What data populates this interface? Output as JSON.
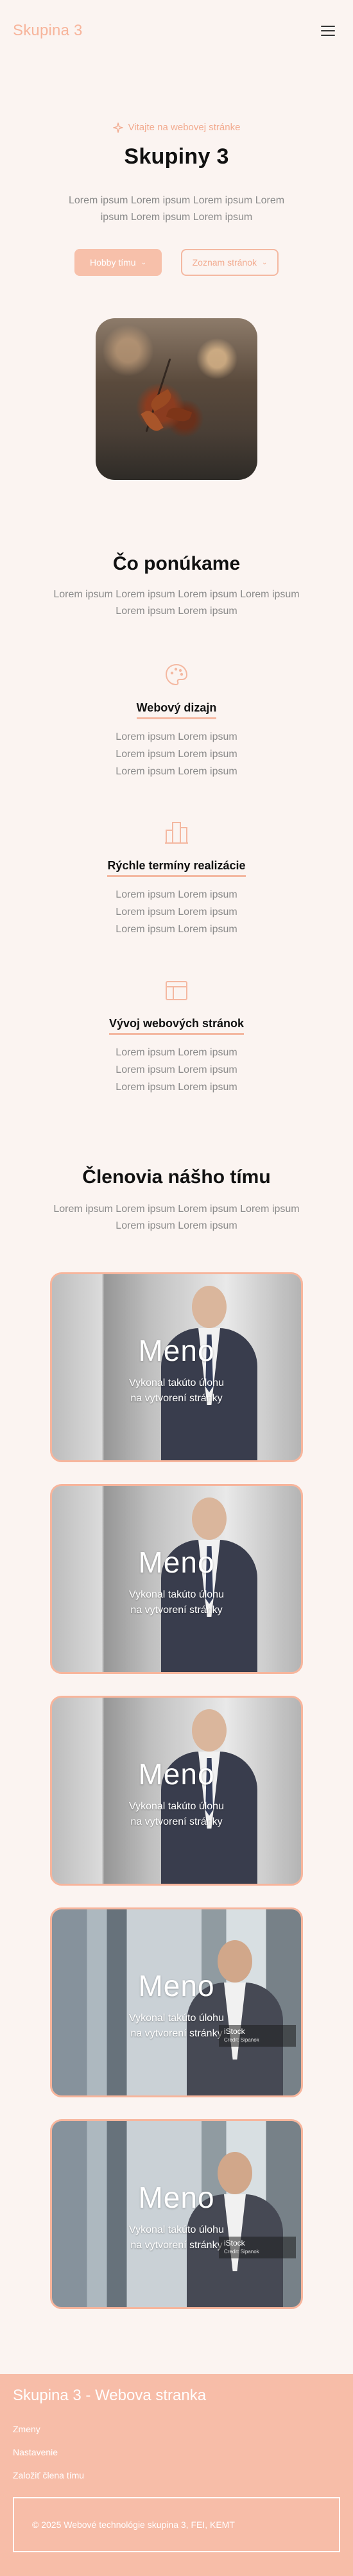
{
  "header": {
    "brand": "Skupina 3"
  },
  "hero": {
    "eyebrow": "Vitajte na webovej stránke",
    "title": "Skupiny 3",
    "text": "Lorem ipsum Lorem ipsum Lorem ipsum Lorem ipsum Lorem ipsum Lorem ipsum",
    "primary_button": "Hobby tímu",
    "secondary_button": "Zoznam stránok"
  },
  "services": {
    "title": "Čo ponúkame",
    "text": "Lorem ipsum Lorem ipsum Lorem ipsum Lorem ipsum Lorem ipsum Lorem ipsum",
    "items": [
      {
        "name": "Webový dizajn",
        "icon": "palette-icon",
        "text": "Lorem ipsum Lorem ipsum Lorem ipsum Lorem ipsum Lorem ipsum Lorem ipsum"
      },
      {
        "name": "Rýchle termíny realizácie",
        "icon": "buildings-icon",
        "text": "Lorem ipsum Lorem ipsum Lorem ipsum Lorem ipsum Lorem ipsum Lorem ipsum"
      },
      {
        "name": "Vývoj webových stránok",
        "icon": "browser-icon",
        "text": "Lorem ipsum Lorem ipsum Lorem ipsum Lorem ipsum Lorem ipsum Lorem ipsum"
      }
    ]
  },
  "team": {
    "title": "Členovia nášho tímu",
    "text": "Lorem ipsum Lorem ipsum Lorem ipsum Lorem ipsum Lorem ipsum Lorem ipsum",
    "members": [
      {
        "name": "Meno",
        "role": "Vykonal takúto úlohu na vytvorení stránky"
      },
      {
        "name": "Meno",
        "role": "Vykonal takúto úlohu na vytvorení stránky"
      },
      {
        "name": "Meno",
        "role": "Vykonal takúto úlohu na vytvorení stránky"
      },
      {
        "name": "Meno",
        "role": "Vykonal takúto úlohu na vytvorení stránky",
        "watermark": "iStock",
        "watermark_credit": "Credit: Sipanok"
      },
      {
        "name": "Meno",
        "role": "Vykonal takúto úlohu na vytvorení stránky",
        "watermark": "iStock",
        "watermark_credit": "Credit: Sipanok"
      }
    ]
  },
  "footer": {
    "title": "Skupina 3 - Webova stranka",
    "links": [
      "Zmeny",
      "Nastavenie",
      "Založiť člena tímu"
    ],
    "copyright": "© 2025 Webové technológie skupina 3, FEI, KEMT"
  },
  "colors": {
    "accent": "#f7b59c",
    "background": "#fbf4f1",
    "footer": "#f7bda8"
  }
}
